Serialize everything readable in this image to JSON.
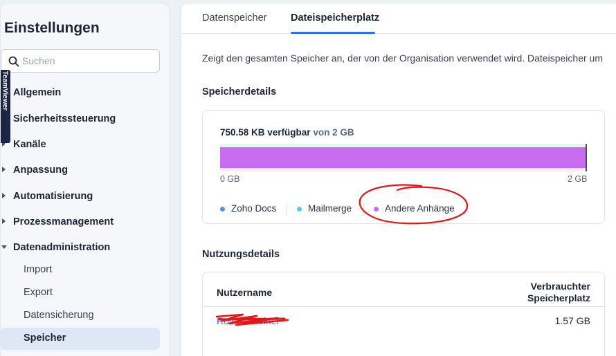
{
  "sidebar": {
    "title": "Einstellungen",
    "search": {
      "placeholder": "Suchen",
      "value": ""
    },
    "items": [
      {
        "label": "Allgemein",
        "expanded": false
      },
      {
        "label": "Sicherheitssteuerung",
        "expanded": false
      },
      {
        "label": "Kanäle",
        "expanded": false
      },
      {
        "label": "Anpassung",
        "expanded": false
      },
      {
        "label": "Automatisierung",
        "expanded": false
      },
      {
        "label": "Prozessmanagement",
        "expanded": false
      },
      {
        "label": "Datenadministration",
        "expanded": true
      }
    ],
    "sub_items": [
      {
        "label": "Import",
        "active": false
      },
      {
        "label": "Export",
        "active": false
      },
      {
        "label": "Datensicherung",
        "active": false
      },
      {
        "label": "Speicher",
        "active": true
      }
    ],
    "teamviewer_label": "TeamViewer"
  },
  "tabs": [
    {
      "label": "Datenspeicher",
      "active": false
    },
    {
      "label": "Dateispeicherplatz",
      "active": true
    }
  ],
  "description": "Zeigt den gesamten Speicher an, der von der Organisation verwendet wird. Dateispeicher um",
  "storage_details": {
    "title": "Speicherdetails",
    "available_value": "750.58 KB verfügbar",
    "available_of": "von 2 GB",
    "used_fraction": 0.9996,
    "axis_min": "0 GB",
    "axis_max": "2 GB",
    "legend": [
      {
        "label": "Zoho Docs",
        "color": "#5b8def"
      },
      {
        "label": "Mailmerge",
        "color": "#5bc8ef"
      },
      {
        "label": "Andere Anhänge",
        "color": "#c86cf0"
      }
    ]
  },
  "usage_details": {
    "title": "Nutzungsdetails",
    "col_user": "Nutzername",
    "col_used": "Verbrauchter Speicherplatz",
    "rows": [
      {
        "user": "Rolf Einsteiner",
        "used": "1.57 GB"
      }
    ]
  },
  "colors": {
    "accent": "#2f6fe4",
    "bar_fill": "#c86cf0",
    "annotation_red": "#e01818"
  }
}
